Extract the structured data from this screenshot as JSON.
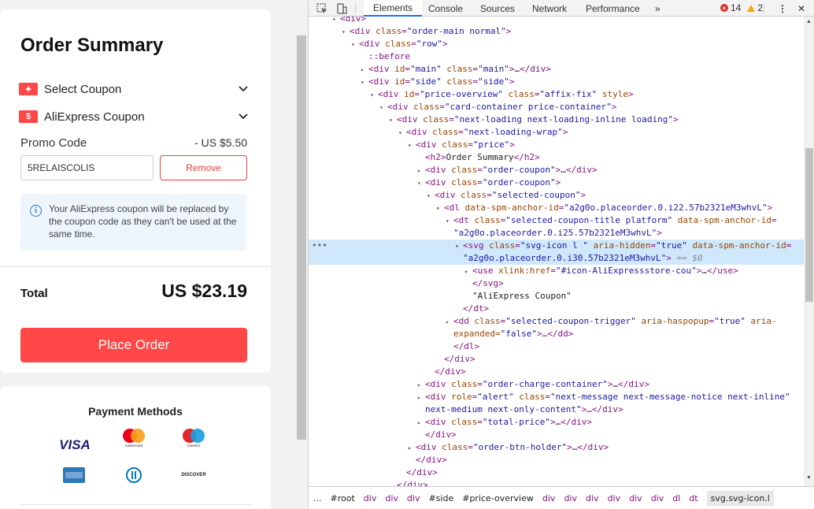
{
  "order_summary": {
    "title": "Order Summary",
    "coupons": [
      {
        "icon": "coupon-icon",
        "label": "Select Coupon"
      },
      {
        "icon": "aliexpress-coupon-icon",
        "label": "AliExpress Coupon"
      }
    ],
    "promo_label": "Promo Code",
    "promo_amount": "- US $5.50",
    "promo_value": "5RELAISCOLIS",
    "remove_label": "Remove",
    "notice": "Your AliExpress coupon will be replaced by the coupon code as they can't be used at the same time.",
    "total_label": "Total",
    "total_value": "US $23.19",
    "place_order_label": "Place Order",
    "accent_color": "#ff4747"
  },
  "payment": {
    "title": "Payment Methods",
    "visa_label": "VISA",
    "mastercard_label": "mastercard",
    "maestro_label": "maestro",
    "discover_label": "DISCOVER"
  },
  "devtools": {
    "tabs": [
      "Elements",
      "Console",
      "Sources",
      "Network",
      "Performance"
    ],
    "more_tabs": "»",
    "error_count": "14",
    "warning_count": "2",
    "breadcrumbs": [
      "...",
      "#root",
      "div",
      "div",
      "div",
      "#side",
      "#price-overview",
      "div",
      "div",
      "div",
      "div",
      "div",
      "div",
      "dl",
      "dt",
      "svg.svg-icon.l"
    ],
    "dom_lines": [
      {
        "indent": 3,
        "tri": "▾",
        "html": "<span class='t'>&lt;div&gt;</span>"
      },
      {
        "indent": 4,
        "tri": "▾",
        "tag": "div",
        "attrs": [
          [
            "class",
            "order-main normal"
          ]
        ]
      },
      {
        "indent": 5,
        "tri": "▾",
        "tag": "div",
        "attrs": [
          [
            "class",
            "row"
          ]
        ]
      },
      {
        "indent": 6,
        "tri": "",
        "pseudo": "::before"
      },
      {
        "indent": 6,
        "tri": "▸",
        "tag": "div",
        "attrs": [
          [
            "id",
            "main"
          ],
          [
            "class",
            "main"
          ]
        ],
        "collapsed": true
      },
      {
        "indent": 6,
        "tri": "▾",
        "tag": "div",
        "attrs": [
          [
            "id",
            "side"
          ],
          [
            "class",
            "side"
          ]
        ]
      },
      {
        "indent": 7,
        "tri": "▾",
        "tag": "div",
        "attrs": [
          [
            "id",
            "price-overview"
          ],
          [
            "class",
            "affix-fix"
          ]
        ],
        "extra": " style"
      },
      {
        "indent": 8,
        "tri": "▾",
        "tag": "div",
        "attrs": [
          [
            "class",
            "card-container price-container"
          ]
        ]
      },
      {
        "indent": 9,
        "tri": "▾",
        "tag": "div",
        "attrs": [
          [
            "class",
            "next-loading next-loading-inline loading"
          ]
        ]
      },
      {
        "indent": 10,
        "tri": "▾",
        "tag": "div",
        "attrs": [
          [
            "class",
            "next-loading-wrap"
          ]
        ]
      },
      {
        "indent": 11,
        "tri": "▾",
        "tag": "div",
        "attrs": [
          [
            "class",
            "price"
          ]
        ]
      },
      {
        "indent": 12,
        "tri": "",
        "text_el": "h2",
        "text": "Order Summary"
      },
      {
        "indent": 12,
        "tri": "▸",
        "tag": "div",
        "attrs": [
          [
            "class",
            "order-coupon"
          ]
        ],
        "collapsed": true
      },
      {
        "indent": 12,
        "tri": "▾",
        "tag": "div",
        "attrs": [
          [
            "class",
            "order-coupon"
          ]
        ]
      },
      {
        "indent": 13,
        "tri": "▾",
        "tag": "div",
        "attrs": [
          [
            "class",
            "selected-coupon"
          ]
        ]
      },
      {
        "indent": 14,
        "tri": "▾",
        "tag": "dl",
        "attrs": [
          [
            "data-spm-anchor-id",
            "a2g0o.placeorder.0.i22.57b2321eM3whvL"
          ]
        ]
      },
      {
        "indent": 15,
        "tri": "▾",
        "tag": "dt",
        "attrs": [
          [
            "class",
            "selected-coupon-title platform"
          ],
          [
            "data-spm-anchor-id",
            ""
          ]
        ],
        "open_end": true
      },
      {
        "indent": 15,
        "tri": "",
        "cont": "\"a2g0o.placeorder.0.i25.57b2321eM3whvL\"",
        "close": "&gt;"
      },
      {
        "indent": 16,
        "tri": "▾",
        "tag": "svg",
        "attrs": [
          [
            "class",
            "svg-icon l "
          ],
          [
            "aria-hidden",
            "true"
          ],
          [
            "data-spm-anchor-id",
            ""
          ]
        ],
        "open_end": true,
        "selected": true
      },
      {
        "indent": 16,
        "tri": "",
        "cont": "\"a2g0o.placeorder.0.i30.57b2321eM3whvL\"",
        "close": "&gt;",
        "eq": " == $0",
        "selected": true
      },
      {
        "indent": 17,
        "tri": "▸",
        "tag": "use",
        "attrs": [
          [
            "xlink:href",
            "#icon-AliExpressstore-cou"
          ]
        ],
        "collapsed": true,
        "trunc": true
      },
      {
        "indent": 17,
        "tri": "",
        "close_tag": "svg"
      },
      {
        "indent": 17,
        "tri": "",
        "text_node": "\"AliExpress Coupon\""
      },
      {
        "indent": 16,
        "tri": "",
        "close_tag": "dt"
      },
      {
        "indent": 15,
        "tri": "▸",
        "tag": "dd",
        "attrs": [
          [
            "class",
            "selected-coupon-trigger"
          ],
          [
            "aria-haspopup",
            "true"
          ],
          [
            "aria-",
            ""
          ]
        ],
        "open_end": true
      },
      {
        "indent": 15,
        "tri": "",
        "cont_plain": "expanded=",
        "cont": "\"false\"",
        "close": "&gt;…&lt;/dd&gt;"
      },
      {
        "indent": 15,
        "tri": "",
        "close_tag": "dl"
      },
      {
        "indent": 14,
        "tri": "",
        "close_tag": "div"
      },
      {
        "indent": 13,
        "tri": "",
        "close_tag": "div"
      },
      {
        "indent": 12,
        "tri": "▸",
        "tag": "div",
        "attrs": [
          [
            "class",
            "order-charge-container"
          ]
        ],
        "collapsed": true
      },
      {
        "indent": 12,
        "tri": "▸",
        "tag": "div",
        "attrs": [
          [
            "role",
            "alert"
          ],
          [
            "class",
            "next-message next-message-notice next-inline"
          ]
        ],
        "open_end": true
      },
      {
        "indent": 12,
        "tri": "",
        "cont": "next-medium next-only-content\"",
        "close": "&gt;…&lt;/div&gt;"
      },
      {
        "indent": 12,
        "tri": "▸",
        "tag": "div",
        "attrs": [
          [
            "class",
            "total-price"
          ]
        ],
        "collapsed": true
      },
      {
        "indent": 12,
        "tri": "",
        "close_tag": "div"
      },
      {
        "indent": 11,
        "tri": "▸",
        "tag": "div",
        "attrs": [
          [
            "class",
            "order-btn-holder"
          ]
        ],
        "collapsed": true
      },
      {
        "indent": 11,
        "tri": "",
        "close_tag": "div"
      },
      {
        "indent": 10,
        "tri": "",
        "close_tag": "div"
      },
      {
        "indent": 9,
        "tri": "",
        "close_tag": "div"
      }
    ]
  }
}
